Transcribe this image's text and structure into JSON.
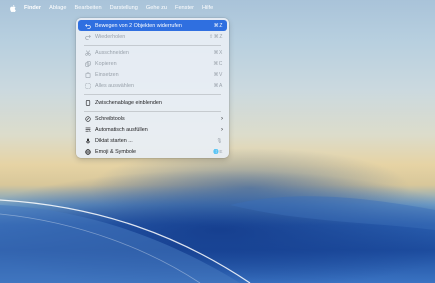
{
  "menubar": {
    "apple": "apple-logo-icon",
    "items": [
      "Finder",
      "Ablage",
      "Bearbeiten",
      "Darstellung",
      "Gehe zu",
      "Fenster",
      "Hilfe"
    ]
  },
  "edit_menu": {
    "undo": {
      "label": "Bewegen von 2 Objekten widerrufen",
      "shortcut": "⌘Z"
    },
    "redo": {
      "label": "Wiederholen",
      "shortcut": "⇧⌘Z"
    },
    "cut": {
      "label": "Ausschneiden",
      "shortcut": "⌘X"
    },
    "copy": {
      "label": "Kopieren",
      "shortcut": "⌘C"
    },
    "paste": {
      "label": "Einsetzen",
      "shortcut": "⌘V"
    },
    "select_all": {
      "label": "Alles auswählen",
      "shortcut": "⌘A"
    },
    "clipboard": {
      "label": "Zwischenablage einblenden"
    },
    "writing_tools": {
      "label": "Schreibtools"
    },
    "autofill": {
      "label": "Automatisch ausfüllen"
    },
    "dictation": {
      "label": "Diktat starten ...",
      "shortcut": "🎙"
    },
    "emoji": {
      "label": "Emoji & Symbole",
      "shortcut": "🌐E"
    }
  },
  "colors": {
    "highlight": "#2f6fe0",
    "disabled_text": "#9aa2ab"
  }
}
